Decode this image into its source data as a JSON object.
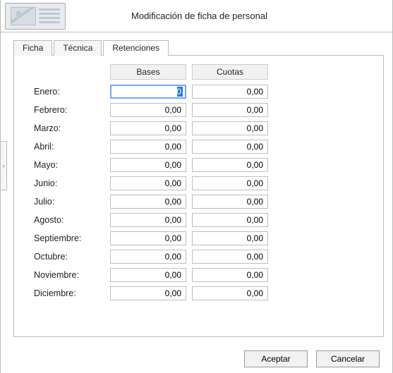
{
  "window": {
    "title": "Modificación de ficha de personal"
  },
  "tabs": {
    "ficha": "Ficha",
    "tecnica": "Técnica",
    "retenciones": "Retenciones",
    "active": "retenciones"
  },
  "columns": {
    "bases": "Bases",
    "cuotas": "Cuotas"
  },
  "months": [
    {
      "label": "Enero:",
      "base": "0",
      "cuota": "0,00",
      "focused": true
    },
    {
      "label": "Febrero:",
      "base": "0,00",
      "cuota": "0,00"
    },
    {
      "label": "Marzo:",
      "base": "0,00",
      "cuota": "0,00"
    },
    {
      "label": "Abril:",
      "base": "0,00",
      "cuota": "0,00"
    },
    {
      "label": "Mayo:",
      "base": "0,00",
      "cuota": "0,00"
    },
    {
      "label": "Junio:",
      "base": "0,00",
      "cuota": "0,00"
    },
    {
      "label": "Julio:",
      "base": "0,00",
      "cuota": "0,00"
    },
    {
      "label": "Agosto:",
      "base": "0,00",
      "cuota": "0,00"
    },
    {
      "label": "Septiembre:",
      "base": "0,00",
      "cuota": "0,00"
    },
    {
      "label": "Octubre:",
      "base": "0,00",
      "cuota": "0,00"
    },
    {
      "label": "Noviembre:",
      "base": "0,00",
      "cuota": "0,00"
    },
    {
      "label": "Diciembre:",
      "base": "0,00",
      "cuota": "0,00"
    }
  ],
  "buttons": {
    "accept": "Aceptar",
    "cancel": "Cancelar"
  },
  "side_handle_glyph": "›"
}
